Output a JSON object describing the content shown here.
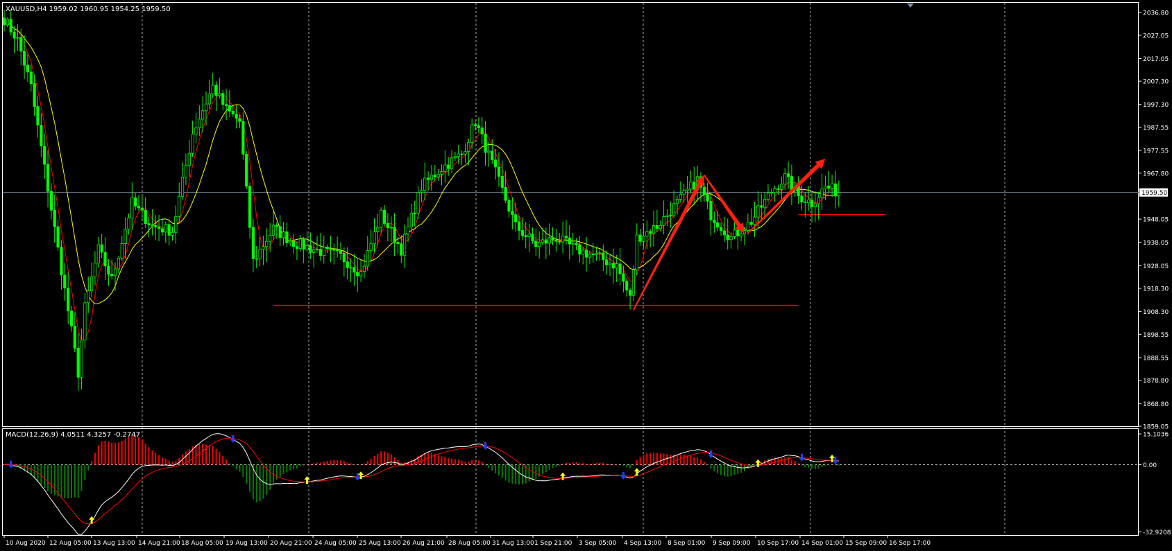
{
  "chart_data": {
    "type": "candlestick",
    "symbol_header": "XAUUSD,H4  1959.02 1960.95 1954.25 1959.50",
    "price_axis": {
      "ticks": [
        "2036.80",
        "2027.05",
        "2017.05",
        "2007.30",
        "1997.30",
        "1987.55",
        "1977.55",
        "1967.80",
        "1959.50",
        "1948.05",
        "1938.05",
        "1928.05",
        "1918.30",
        "1908.30",
        "1898.55",
        "1888.55",
        "1878.80",
        "1868.80",
        "1859.05"
      ],
      "range": [
        1859.05,
        2041.0
      ],
      "current_price": 1959.5
    },
    "time_axis_labels": [
      "10 Aug 2020",
      "12 Aug 05:00",
      "13 Aug 13:00",
      "14 Aug 21:00",
      "18 Aug 05:00",
      "19 Aug 13:00",
      "20 Aug 21:00",
      "24 Aug 05:00",
      "25 Aug 13:00",
      "26 Aug 21:00",
      "28 Aug 05:00",
      "31 Aug 13:00",
      "1 Sep 21:00",
      "3 Sep 05:00",
      "4 Sep 13:00",
      "8 Sep 01:00",
      "9 Sep 09:00",
      "10 Sep 17:00",
      "14 Sep 01:00",
      "15 Sep 09:00",
      "16 Sep 17:00"
    ],
    "price_path": [
      {
        "i": 0,
        "p": 2034
      },
      {
        "i": 4,
        "p": 2025
      },
      {
        "i": 8,
        "p": 2005
      },
      {
        "i": 12,
        "p": 1970
      },
      {
        "i": 16,
        "p": 1935
      },
      {
        "i": 20,
        "p": 1900
      },
      {
        "i": 22,
        "p": 1882
      },
      {
        "i": 24,
        "p": 1910
      },
      {
        "i": 28,
        "p": 1935
      },
      {
        "i": 32,
        "p": 1922
      },
      {
        "i": 38,
        "p": 1955
      },
      {
        "i": 44,
        "p": 1945
      },
      {
        "i": 50,
        "p": 1943
      },
      {
        "i": 56,
        "p": 1985
      },
      {
        "i": 62,
        "p": 2005
      },
      {
        "i": 66,
        "p": 1995
      },
      {
        "i": 70,
        "p": 1990
      },
      {
        "i": 74,
        "p": 1930
      },
      {
        "i": 80,
        "p": 1944
      },
      {
        "i": 86,
        "p": 1938
      },
      {
        "i": 92,
        "p": 1935
      },
      {
        "i": 100,
        "p": 1932
      },
      {
        "i": 106,
        "p": 1925
      },
      {
        "i": 112,
        "p": 1950
      },
      {
        "i": 118,
        "p": 1935
      },
      {
        "i": 124,
        "p": 1962
      },
      {
        "i": 130,
        "p": 1970
      },
      {
        "i": 136,
        "p": 1976
      },
      {
        "i": 140,
        "p": 1990
      },
      {
        "i": 146,
        "p": 1968
      },
      {
        "i": 152,
        "p": 1945
      },
      {
        "i": 158,
        "p": 1937
      },
      {
        "i": 164,
        "p": 1940
      },
      {
        "i": 170,
        "p": 1935
      },
      {
        "i": 176,
        "p": 1932
      },
      {
        "i": 182,
        "p": 1928
      },
      {
        "i": 186,
        "p": 1914
      },
      {
        "i": 188,
        "p": 1940
      },
      {
        "i": 194,
        "p": 1945
      },
      {
        "i": 200,
        "p": 1955
      },
      {
        "i": 206,
        "p": 1965
      },
      {
        "i": 210,
        "p": 1950
      },
      {
        "i": 216,
        "p": 1940
      },
      {
        "i": 222,
        "p": 1947
      },
      {
        "i": 228,
        "p": 1960
      },
      {
        "i": 232,
        "p": 1966
      },
      {
        "i": 236,
        "p": 1958
      },
      {
        "i": 240,
        "p": 1955
      },
      {
        "i": 244,
        "p": 1962
      },
      {
        "i": 248,
        "p": 1959.5
      }
    ],
    "support_lines": [
      {
        "price": 1911,
        "from_i": 80,
        "to_i": 236
      },
      {
        "price": 1950,
        "from_i": 236,
        "to_i": 262
      }
    ],
    "arrows": [
      {
        "from_i": 187,
        "from_p": 1909,
        "to_i": 208,
        "to_p": 1967
      },
      {
        "from_i": 208,
        "from_p": 1967,
        "to_i": 220,
        "to_p": 1942
      },
      {
        "from_i": 221,
        "from_p": 1942,
        "to_i": 244,
        "to_p": 1974
      }
    ],
    "macd": {
      "header": "MACD(12,26,9) 4.0511 4.3257 -0.2747",
      "ticks": [
        "15.1036",
        "0.00",
        "-32.9208"
      ],
      "range": [
        -34.5,
        17.5
      ]
    },
    "colors": {
      "background": "#000000",
      "bull": "#00ff00",
      "bear": "#000000",
      "fast_ma": "#ff0000",
      "slow_ma": "#ffff00",
      "support": "#ff0000",
      "arrow": "#ff2010",
      "grid": "#ffffff",
      "price_line": "#708090",
      "macd_line": "#ffffff",
      "signal_line": "#ff0000",
      "hist_pos": "#ff0000",
      "hist_neg": "#008000"
    }
  }
}
